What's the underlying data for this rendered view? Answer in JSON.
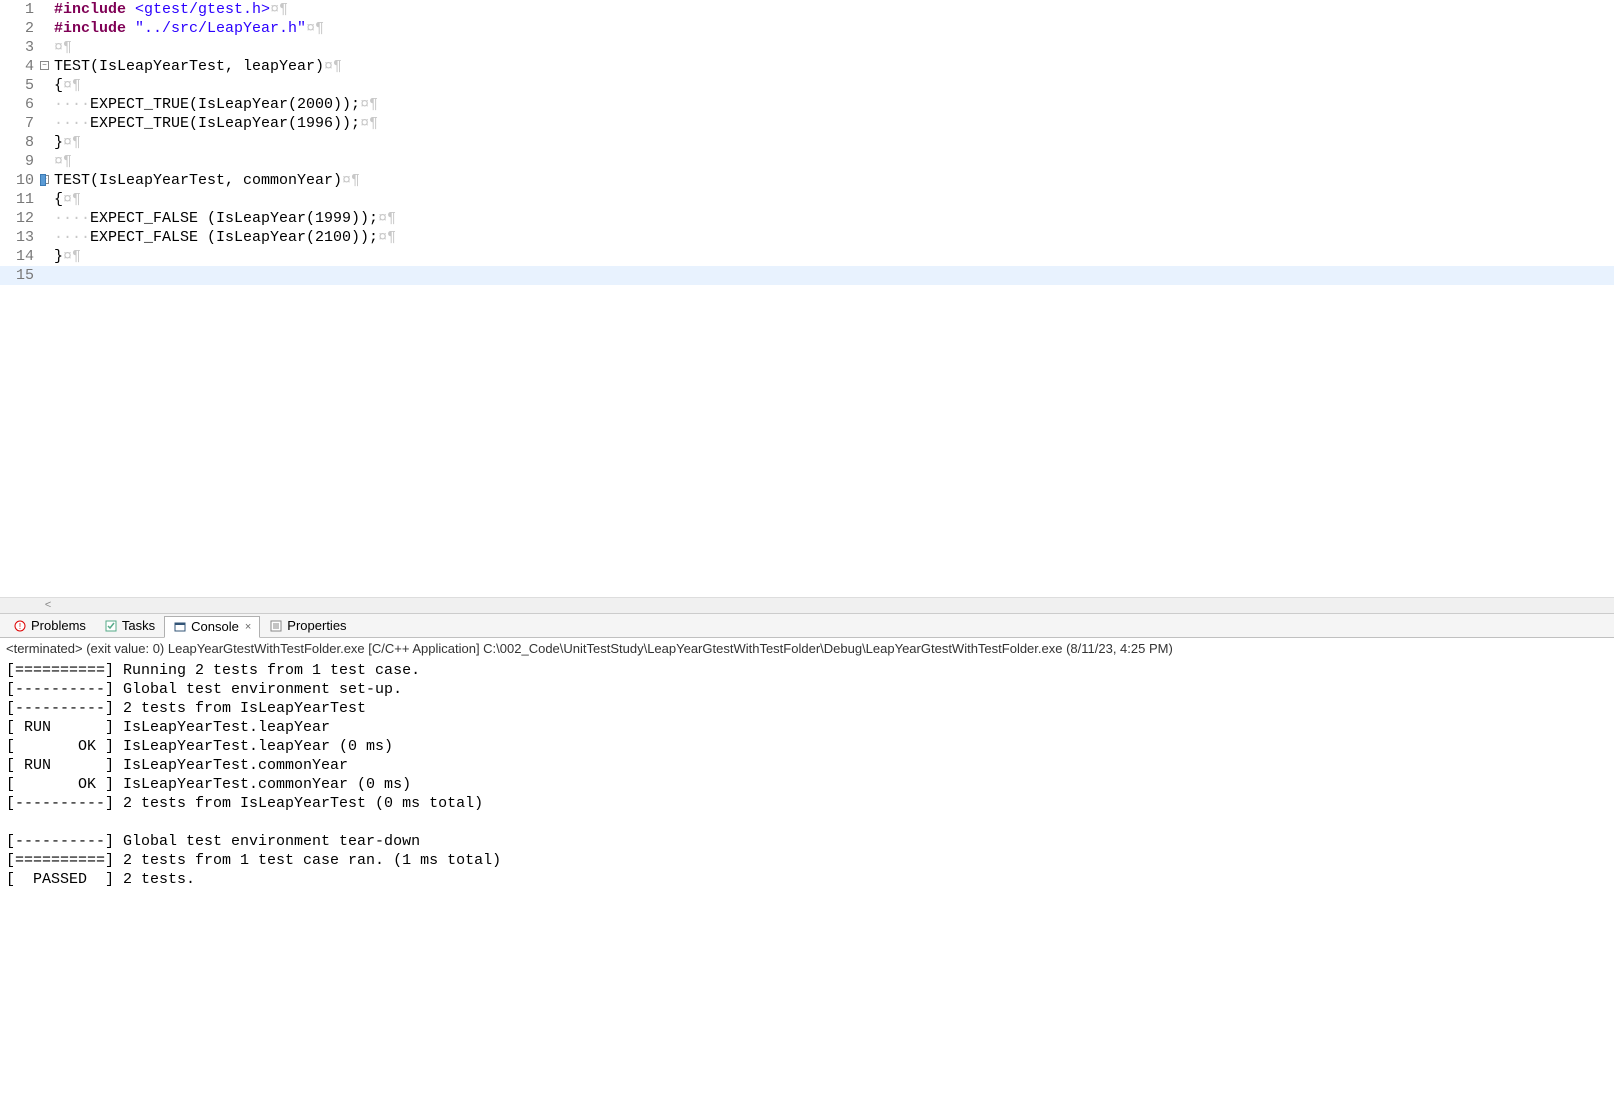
{
  "editor": {
    "lines": [
      {
        "n": 1,
        "fold": "",
        "segments": [
          {
            "cls": "kw",
            "t": "#include"
          },
          {
            "cls": "",
            "t": " "
          },
          {
            "cls": "inc",
            "t": "<gtest/gtest.h>"
          },
          {
            "cls": "ws",
            "t": "¤¶"
          }
        ]
      },
      {
        "n": 2,
        "fold": "",
        "segments": [
          {
            "cls": "kw",
            "t": "#include"
          },
          {
            "cls": "",
            "t": " "
          },
          {
            "cls": "str",
            "t": "\"../src/LeapYear.h\""
          },
          {
            "cls": "ws",
            "t": "¤¶"
          }
        ]
      },
      {
        "n": 3,
        "fold": "",
        "segments": [
          {
            "cls": "ws",
            "t": "¤¶"
          }
        ]
      },
      {
        "n": 4,
        "fold": "minus",
        "segments": [
          {
            "cls": "",
            "t": "TEST(IsLeapYearTest, leapYear)"
          },
          {
            "cls": "ws",
            "t": "¤¶"
          }
        ]
      },
      {
        "n": 5,
        "fold": "",
        "segments": [
          {
            "cls": "",
            "t": "{"
          },
          {
            "cls": "ws",
            "t": "¤¶"
          }
        ]
      },
      {
        "n": 6,
        "fold": "",
        "segments": [
          {
            "cls": "ws",
            "t": "····"
          },
          {
            "cls": "",
            "t": "EXPECT_TRUE(IsLeapYear(2000));"
          },
          {
            "cls": "ws",
            "t": "¤¶"
          }
        ]
      },
      {
        "n": 7,
        "fold": "",
        "segments": [
          {
            "cls": "ws",
            "t": "····"
          },
          {
            "cls": "",
            "t": "EXPECT_TRUE(IsLeapYear(1996));"
          },
          {
            "cls": "ws",
            "t": "¤¶"
          }
        ]
      },
      {
        "n": 8,
        "fold": "",
        "segments": [
          {
            "cls": "",
            "t": "}"
          },
          {
            "cls": "ws",
            "t": "¤¶"
          }
        ]
      },
      {
        "n": 9,
        "fold": "",
        "segments": [
          {
            "cls": "ws",
            "t": "¤¶"
          }
        ]
      },
      {
        "n": 10,
        "fold": "minus",
        "mark": true,
        "segments": [
          {
            "cls": "",
            "t": "TEST(IsLeapYearTest, commonYear)"
          },
          {
            "cls": "ws",
            "t": "¤¶"
          }
        ]
      },
      {
        "n": 11,
        "fold": "",
        "segments": [
          {
            "cls": "",
            "t": "{"
          },
          {
            "cls": "ws",
            "t": "¤¶"
          }
        ]
      },
      {
        "n": 12,
        "fold": "",
        "segments": [
          {
            "cls": "ws",
            "t": "····"
          },
          {
            "cls": "",
            "t": "EXPECT_FALSE (IsLeapYear(1999));"
          },
          {
            "cls": "ws",
            "t": "¤¶"
          }
        ]
      },
      {
        "n": 13,
        "fold": "",
        "segments": [
          {
            "cls": "ws",
            "t": "····"
          },
          {
            "cls": "",
            "t": "EXPECT_FALSE (IsLeapYear(2100));"
          },
          {
            "cls": "ws",
            "t": "¤¶"
          }
        ]
      },
      {
        "n": 14,
        "fold": "",
        "segments": [
          {
            "cls": "",
            "t": "}"
          },
          {
            "cls": "ws",
            "t": "¤¶"
          }
        ]
      },
      {
        "n": 15,
        "fold": "",
        "current": true,
        "segments": []
      }
    ]
  },
  "tabs": {
    "problems": "Problems",
    "tasks": "Tasks",
    "console": "Console",
    "properties": "Properties"
  },
  "console": {
    "header": "<terminated> (exit value: 0) LeapYearGtestWithTestFolder.exe [C/C++ Application] C:\\002_Code\\UnitTestStudy\\LeapYearGtestWithTestFolder\\Debug\\LeapYearGtestWithTestFolder.exe (8/11/23, 4:25 PM)",
    "output": "[==========] Running 2 tests from 1 test case.\n[----------] Global test environment set-up.\n[----------] 2 tests from IsLeapYearTest\n[ RUN      ] IsLeapYearTest.leapYear\n[       OK ] IsLeapYearTest.leapYear (0 ms)\n[ RUN      ] IsLeapYearTest.commonYear\n[       OK ] IsLeapYearTest.commonYear (0 ms)\n[----------] 2 tests from IsLeapYearTest (0 ms total)\n\n[----------] Global test environment tear-down\n[==========] 2 tests from 1 test case ran. (1 ms total)\n[  PASSED  ] 2 tests."
  }
}
